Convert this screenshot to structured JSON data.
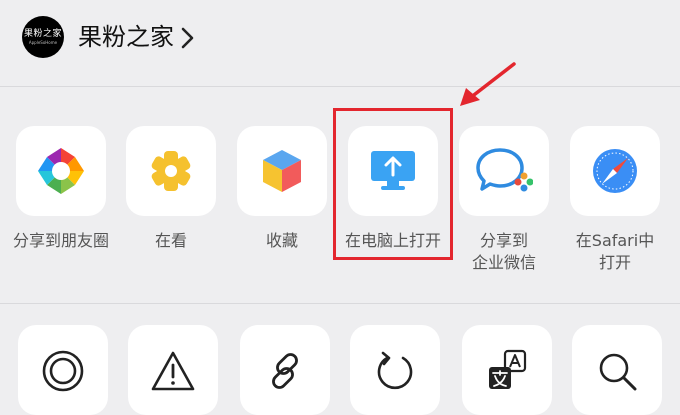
{
  "header": {
    "avatar_text": "果粉之家",
    "avatar_subtext": "AppleSoHome",
    "title": "果粉之家"
  },
  "share_row": [
    {
      "icon": "photo-aperture-icon",
      "label": "分享到朋友圈"
    },
    {
      "icon": "wow-star-icon",
      "label": "在看"
    },
    {
      "icon": "favorites-cube-icon",
      "label": "收藏"
    },
    {
      "icon": "computer-upload-icon",
      "label": "在电脑上打开"
    },
    {
      "icon": "wecom-chat-icon",
      "label_line1": "分享到",
      "label_line2": "企业微信"
    },
    {
      "icon": "safari-compass-icon",
      "label_line1": "在Safari中",
      "label_line2": "打开"
    }
  ],
  "action_row": [
    {
      "icon": "floating-window-icon"
    },
    {
      "icon": "warning-triangle-icon"
    },
    {
      "icon": "link-icon"
    },
    {
      "icon": "refresh-icon"
    },
    {
      "icon": "translate-icon"
    },
    {
      "icon": "search-icon"
    }
  ],
  "colors": {
    "highlight": "#e3262e",
    "tile_background": "#ffffff",
    "panel_background": "#eeeef0",
    "label": "#555555",
    "upload_blue": "#3aa3f3"
  }
}
